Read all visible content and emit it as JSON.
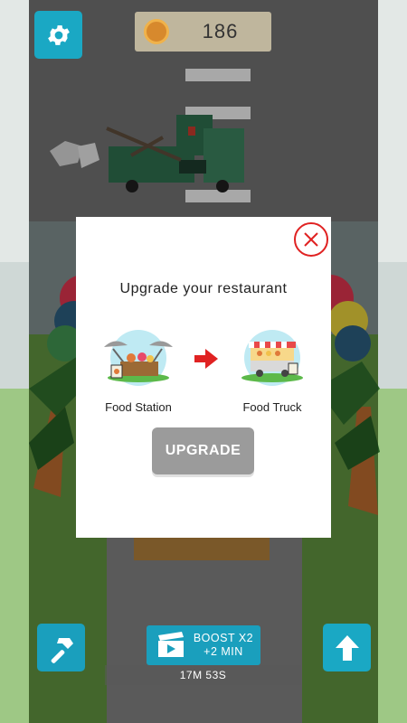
{
  "hud": {
    "coin_count": "186",
    "coin_icon": "coin-icon",
    "settings_icon": "gear-icon"
  },
  "modal": {
    "title": "Upgrade your restaurant",
    "from_label": "Food Station",
    "to_label": "Food Truck",
    "upgrade_label": "UPGRADE",
    "close_icon": "close-icon"
  },
  "bottom_bar": {
    "boost_line1": "BOOST X2",
    "boost_line2": "+2 MIN",
    "timer": "17M 53S",
    "hammer_icon": "hammer-icon",
    "up_icon": "arrow-up-icon",
    "video_icon": "video-clapper-icon"
  },
  "colors": {
    "accent": "#1aa8c4",
    "close_red": "#e02222",
    "button_grey": "#9b9b9b"
  }
}
